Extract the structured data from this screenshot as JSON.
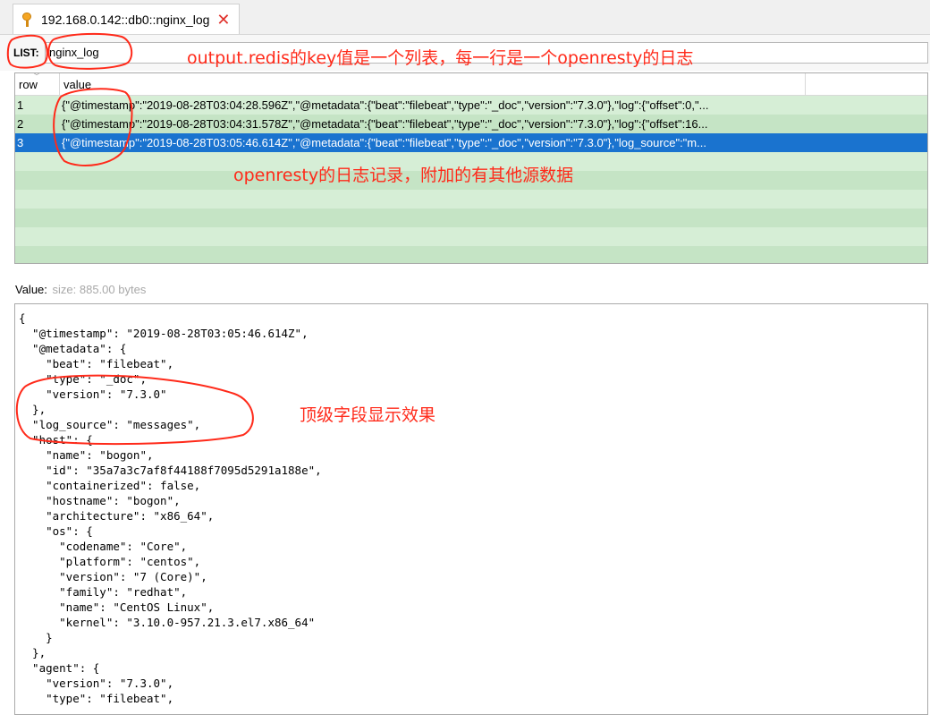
{
  "tab": {
    "title": "192.168.0.142::db0::nginx_log",
    "close_glyph": "✕",
    "icon": "key-icon"
  },
  "list": {
    "label": "LIST:",
    "key_value": "nginx_log"
  },
  "table": {
    "columns": [
      "row",
      "value"
    ],
    "rows": [
      {
        "row": "1",
        "value": "{\"@timestamp\":\"2019-08-28T03:04:28.596Z\",\"@metadata\":{\"beat\":\"filebeat\",\"type\":\"_doc\",\"version\":\"7.3.0\"},\"log\":{\"offset\":0,\"..."
      },
      {
        "row": "2",
        "value": "{\"@timestamp\":\"2019-08-28T03:04:31.578Z\",\"@metadata\":{\"beat\":\"filebeat\",\"type\":\"_doc\",\"version\":\"7.3.0\"},\"log\":{\"offset\":16..."
      },
      {
        "row": "3",
        "value": "{\"@timestamp\":\"2019-08-28T03:05:46.614Z\",\"@metadata\":{\"beat\":\"filebeat\",\"type\":\"_doc\",\"version\":\"7.3.0\"},\"log_source\":\"m..."
      }
    ],
    "selected_row": "3"
  },
  "value": {
    "label": "Value:",
    "size": "size: 885.00 bytes",
    "json_lines": [
      "{",
      "  \"@timestamp\": \"2019-08-28T03:05:46.614Z\",",
      "  \"@metadata\": {",
      "    \"beat\": \"filebeat\",",
      "    \"type\": \"_doc\",",
      "    \"version\": \"7.3.0\"",
      "  },",
      "  \"log_source\": \"messages\",",
      "  \"host\": {",
      "    \"name\": \"bogon\",",
      "    \"id\": \"35a7a3c7af8f44188f7095d5291a188e\",",
      "    \"containerized\": false,",
      "    \"hostname\": \"bogon\",",
      "    \"architecture\": \"x86_64\",",
      "    \"os\": {",
      "      \"codename\": \"Core\",",
      "      \"platform\": \"centos\",",
      "      \"version\": \"7 (Core)\",",
      "      \"family\": \"redhat\",",
      "      \"name\": \"CentOS Linux\",",
      "      \"kernel\": \"3.10.0-957.21.3.el7.x86_64\"",
      "    }",
      "  },",
      "  \"agent\": {",
      "    \"version\": \"7.3.0\",",
      "    \"type\": \"filebeat\","
    ]
  },
  "annotations": {
    "key_note": "output.redis的key值是一个列表，每一行是一个openresty的日志",
    "log_note": "openresty的日志记录，附加的有其他源数据",
    "top_level_note": "顶级字段显示效果",
    "color": "#ff2a1a"
  },
  "colors": {
    "row_light": "#d6eed6",
    "row_dark": "#c5e4c5",
    "row_selected": "#1a73cf"
  }
}
